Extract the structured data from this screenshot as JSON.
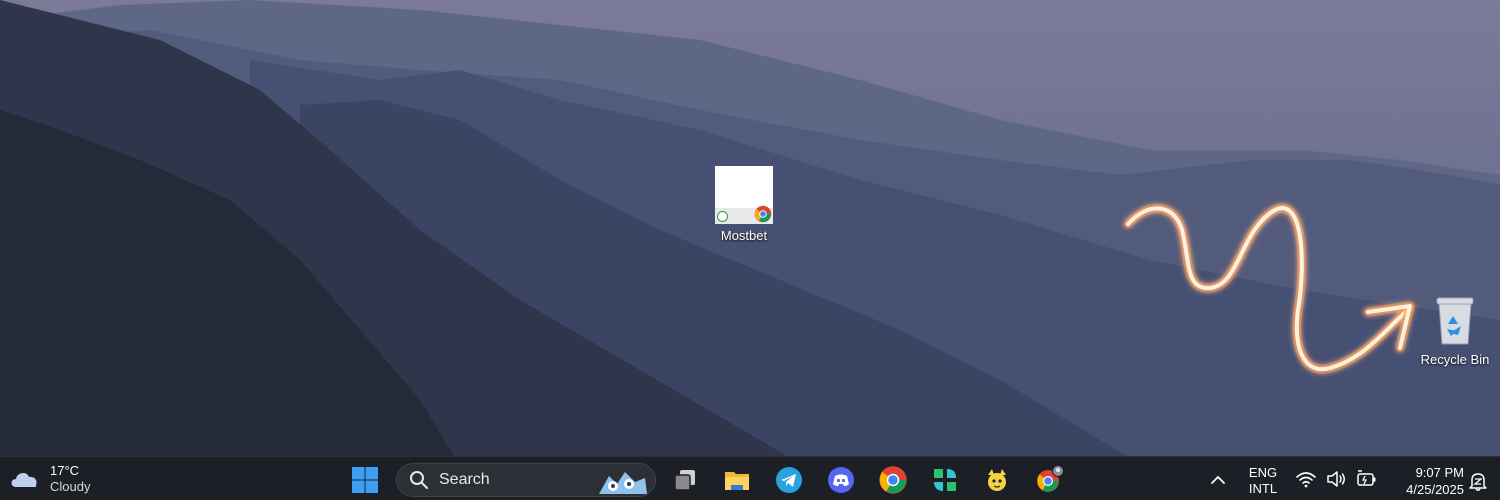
{
  "desktop": {
    "icons": [
      {
        "label": "Mostbet",
        "icon": "chrome-shortcut-icon"
      },
      {
        "label": "Recycle Bin",
        "icon": "recycle-bin-icon"
      }
    ],
    "annotation_color": "#ff8a1e"
  },
  "taskbar": {
    "weather": {
      "temp": "17°C",
      "condition": "Cloudy",
      "icon": "cloud-icon"
    },
    "search": {
      "placeholder": "Search"
    },
    "apps": [
      {
        "name": "start-button",
        "icon": "windows-logo-icon"
      },
      {
        "name": "task-view",
        "icon": "task-view-icon"
      },
      {
        "name": "file-explorer",
        "icon": "folder-icon"
      },
      {
        "name": "telegram",
        "icon": "telegram-icon"
      },
      {
        "name": "discord",
        "icon": "discord-icon"
      },
      {
        "name": "chrome",
        "icon": "chrome-icon"
      },
      {
        "name": "app-green",
        "icon": "green-app-icon"
      },
      {
        "name": "app-character",
        "icon": "character-app-icon"
      },
      {
        "name": "chrome-profile",
        "icon": "chrome-profile-icon"
      }
    ],
    "tray": {
      "lang_line1": "ENG",
      "lang_line2": "INTL",
      "time": "9:07 PM",
      "date": "4/25/2025"
    }
  }
}
